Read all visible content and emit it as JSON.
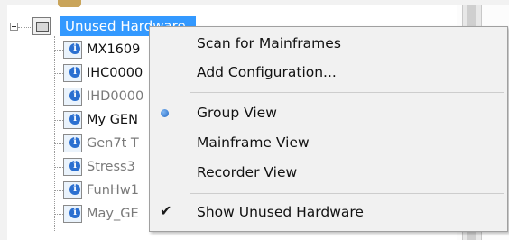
{
  "tree": {
    "root_label": "Unused Hardware",
    "children": [
      {
        "label": "MX1609",
        "muted": false
      },
      {
        "label": "IHC0000",
        "muted": false
      },
      {
        "label": "IHD0000",
        "muted": true
      },
      {
        "label": "My GEN",
        "muted": false
      },
      {
        "label": "Gen7t T",
        "muted": true
      },
      {
        "label": "Stress3",
        "muted": true
      },
      {
        "label": "FunHw1",
        "muted": true
      },
      {
        "label": "May_GE",
        "muted": true
      }
    ]
  },
  "context_menu": {
    "items": [
      {
        "label": "Scan for Mainframes",
        "indicator": "none"
      },
      {
        "label": "Add Configuration...",
        "indicator": "none"
      },
      {
        "label": "Group View",
        "indicator": "radio"
      },
      {
        "label": "Mainframe View",
        "indicator": "none"
      },
      {
        "label": "Recorder View",
        "indicator": "none"
      },
      {
        "label": "Show Unused Hardware",
        "indicator": "check"
      }
    ]
  },
  "colors": {
    "selection": "#3399ff",
    "menu_background": "#f1f1f1"
  }
}
